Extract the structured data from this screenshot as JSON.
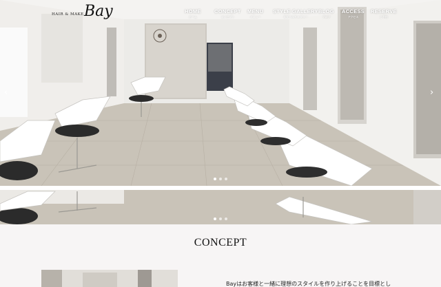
{
  "logo": {
    "small_text": "HAIR & MAKE",
    "big_text": "Bay"
  },
  "nav": [
    {
      "en": "HOME",
      "ja": "ホーム"
    },
    {
      "en": "CONCEPT",
      "ja": "コンセプト"
    },
    {
      "en": "MENU",
      "ja": "メニュー"
    },
    {
      "en": "STYLE GALLERY",
      "ja": "スタイルギャラリー"
    },
    {
      "en": "BLOG",
      "ja": "ブログ"
    },
    {
      "en": "ACCESS",
      "ja": "アクセス"
    },
    {
      "en": "RESERVE",
      "ja": "ご予約"
    }
  ],
  "slider": {
    "prev_symbol": "‹",
    "next_symbol": "›",
    "active_index": 0
  },
  "concept": {
    "title": "CONCEPT",
    "text": "Bayはお客様と一緒に理想のスタイルを作り上げることを目標とし"
  },
  "colors": {
    "accent": "#111111",
    "concept_bg": "#f7f5f5"
  }
}
